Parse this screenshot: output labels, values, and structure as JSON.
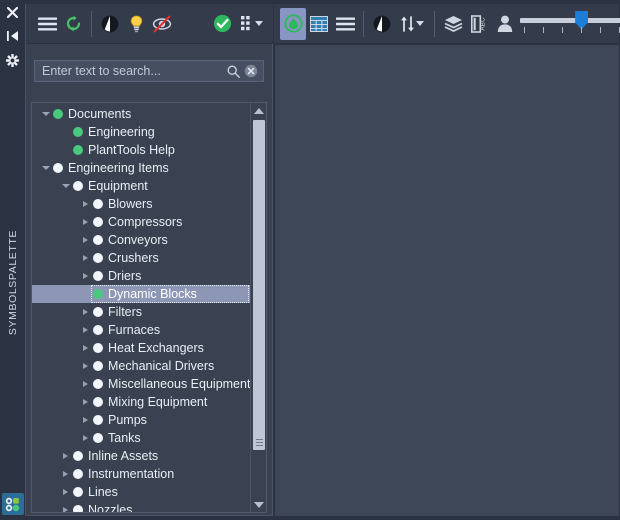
{
  "rail": {
    "close_label": "close",
    "autohide_label": "auto-hide",
    "settings_label": "settings",
    "vertical_title": "SYMBOLSPALETTE",
    "bottom_tool_label": "symbol palette"
  },
  "toolbar_left": {
    "buttons": [
      {
        "name": "menu-icon",
        "label": "Menu"
      },
      {
        "name": "refresh-icon",
        "label": "Refresh"
      },
      {
        "name": "contrast-icon",
        "label": "Contrast"
      },
      {
        "name": "lightbulb-icon",
        "label": "Highlight"
      },
      {
        "name": "hide-preview-icon",
        "label": "Hide preview"
      },
      {
        "name": "check-circle-icon",
        "label": "Apply"
      },
      {
        "name": "grid-dots-icon",
        "label": "Options"
      }
    ]
  },
  "toolbar_right": {
    "buttons": [
      {
        "name": "symbol-active-icon",
        "label": "Symbols"
      },
      {
        "name": "table-grid-icon",
        "label": "Table view"
      },
      {
        "name": "list-icon",
        "label": "List view"
      },
      {
        "name": "contrast-icon",
        "label": "Contrast"
      },
      {
        "name": "sort-icon",
        "label": "Sort"
      },
      {
        "name": "layers-icon",
        "label": "Layers"
      },
      {
        "name": "label-abc-icon",
        "label": "Labels"
      },
      {
        "name": "user-icon",
        "label": "User"
      }
    ],
    "slider": {
      "name": "zoom-slider",
      "value": 4,
      "min": 1,
      "max": 6,
      "ticks": 6
    }
  },
  "search": {
    "placeholder": "Enter text to search...",
    "value": "",
    "search_icon": "search-icon",
    "clear_icon": "clear-icon"
  },
  "tree": {
    "items": [
      {
        "label": "Documents",
        "indent": 0,
        "expander": "down",
        "dot": "green"
      },
      {
        "label": "Engineering",
        "indent": 1,
        "expander": "none",
        "dot": "green"
      },
      {
        "label": "PlantTools Help",
        "indent": 1,
        "expander": "none",
        "dot": "green"
      },
      {
        "label": "Engineering Items",
        "indent": 0,
        "expander": "down",
        "dot": "white"
      },
      {
        "label": "Equipment",
        "indent": 1,
        "expander": "down",
        "dot": "white"
      },
      {
        "label": "Blowers",
        "indent": 2,
        "expander": "right",
        "dot": "white"
      },
      {
        "label": "Compressors",
        "indent": 2,
        "expander": "right",
        "dot": "white"
      },
      {
        "label": "Conveyors",
        "indent": 2,
        "expander": "right",
        "dot": "white"
      },
      {
        "label": "Crushers",
        "indent": 2,
        "expander": "right",
        "dot": "white"
      },
      {
        "label": "Driers",
        "indent": 2,
        "expander": "right",
        "dot": "white"
      },
      {
        "label": "Dynamic Blocks",
        "indent": 2,
        "expander": "none",
        "dot": "green",
        "selected": true
      },
      {
        "label": "Filters",
        "indent": 2,
        "expander": "right",
        "dot": "white"
      },
      {
        "label": "Furnaces",
        "indent": 2,
        "expander": "right",
        "dot": "white"
      },
      {
        "label": "Heat Exchangers",
        "indent": 2,
        "expander": "right",
        "dot": "white"
      },
      {
        "label": "Mechanical Drivers",
        "indent": 2,
        "expander": "right",
        "dot": "white"
      },
      {
        "label": "Miscellaneous Equipment",
        "indent": 2,
        "expander": "right",
        "dot": "white"
      },
      {
        "label": "Mixing Equipment",
        "indent": 2,
        "expander": "right",
        "dot": "white"
      },
      {
        "label": "Pumps",
        "indent": 2,
        "expander": "right",
        "dot": "white"
      },
      {
        "label": "Tanks",
        "indent": 2,
        "expander": "right",
        "dot": "white"
      },
      {
        "label": "Inline Assets",
        "indent": 1,
        "expander": "right",
        "dot": "white"
      },
      {
        "label": "Instrumentation",
        "indent": 1,
        "expander": "right",
        "dot": "white"
      },
      {
        "label": "Lines",
        "indent": 1,
        "expander": "right",
        "dot": "white"
      },
      {
        "label": "Nozzles",
        "indent": 1,
        "expander": "right",
        "dot": "white"
      }
    ]
  },
  "colors": {
    "accent_green": "#49c97e",
    "accent_blue": "#1c7ed6",
    "selection": "#8d97b5",
    "panel_bg": "#3a4252",
    "canvas_bg": "#3e4758",
    "window_bg": "#2b3241"
  }
}
